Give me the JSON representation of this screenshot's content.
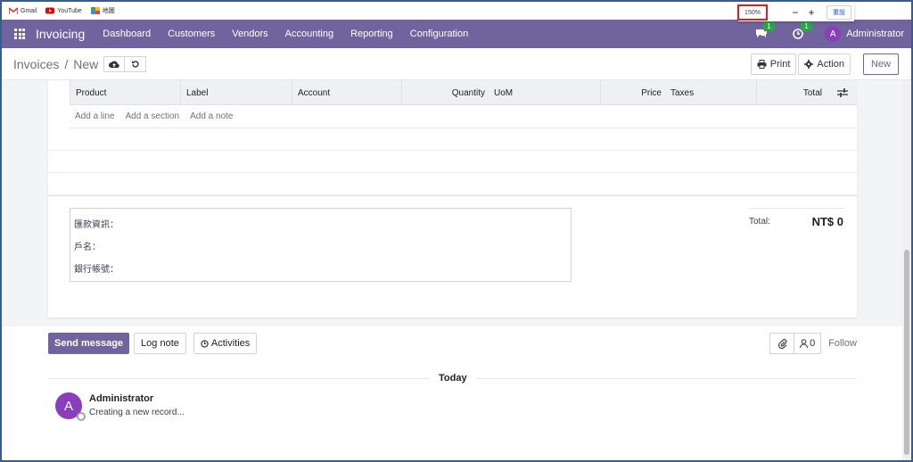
{
  "bookmarks": [
    {
      "label": "Gmail",
      "icon": "gmail-icon"
    },
    {
      "label": "YouTube",
      "icon": "youtube-icon"
    },
    {
      "label": "地圖",
      "icon": "maps-icon"
    }
  ],
  "zoom": {
    "value": "150%",
    "minus": "−",
    "plus": "+",
    "reset": "重設"
  },
  "navbar": {
    "brand": "Invoicing",
    "menu": [
      "Dashboard",
      "Customers",
      "Vendors",
      "Accounting",
      "Reporting",
      "Configuration"
    ],
    "messages_badge": "1",
    "activities_badge": "1",
    "user_initial": "A",
    "user_name": "Administrator",
    "color": "#71639e"
  },
  "control": {
    "breadcrumb_parent": "Invoices",
    "breadcrumb_sep": "/",
    "breadcrumb_current": "New",
    "print": "Print",
    "action": "Action",
    "new": "New"
  },
  "lines": {
    "headers": [
      "Product",
      "Label",
      "Account",
      "Quantity",
      "UoM",
      "Price",
      "Taxes",
      "Total"
    ],
    "add_line": "Add a line",
    "add_section": "Add a section",
    "add_note": "Add a note"
  },
  "notes": [
    "匯款資訊：",
    "戶名：",
    "銀行帳號："
  ],
  "totals": {
    "label": "Total:",
    "value": "NT$ 0"
  },
  "chatter": {
    "send_message": "Send message",
    "log_note": "Log note",
    "activities": "Activities",
    "followers": "0",
    "follow": "Follow",
    "today": "Today",
    "author": "Administrator",
    "author_initial": "A",
    "body": "Creating a new record..."
  }
}
